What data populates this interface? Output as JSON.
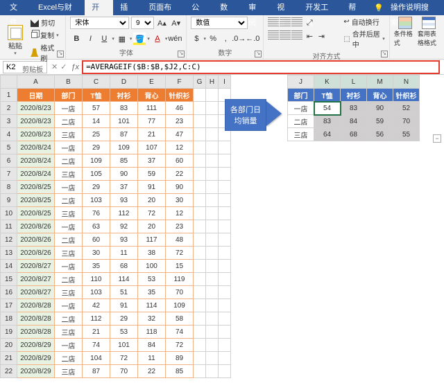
{
  "titlebar": {
    "tabs": [
      "文件",
      "Excel与财务",
      "开始",
      "插入",
      "页面布局",
      "公式",
      "数据",
      "审阅",
      "视图",
      "开发工具",
      "帮助"
    ],
    "active_index": 2,
    "tell_me": "操作说明搜索"
  },
  "ribbon": {
    "clipboard": {
      "paste": "粘贴",
      "cut": "剪切",
      "copy": "复制",
      "brush": "格式刷",
      "label": "剪贴板"
    },
    "font": {
      "name": "宋体",
      "size": "9",
      "label": "字体"
    },
    "number": {
      "format": "数值",
      "label": "数字"
    },
    "align": {
      "wrap": "自动换行",
      "merge": "合并后居中",
      "label": "对齐方式"
    },
    "styles": {
      "cond": "条件格式",
      "table": "套用表格格式"
    }
  },
  "formula_bar": {
    "name_box": "K2",
    "formula": "=AVERAGEIF($B:$B,$J2,C:C)"
  },
  "columns_left": [
    "A",
    "B",
    "C",
    "D",
    "E",
    "F",
    "G",
    "H",
    "I"
  ],
  "columns_right": [
    "J",
    "K",
    "L",
    "M",
    "N"
  ],
  "left_header": [
    "日期",
    "部门",
    "T恤",
    "衬衫",
    "背心",
    "针织衫"
  ],
  "left_rows": [
    [
      "2020/8/23",
      "一店",
      "57",
      "83",
      "111",
      "46"
    ],
    [
      "2020/8/23",
      "二店",
      "14",
      "101",
      "77",
      "23"
    ],
    [
      "2020/8/23",
      "三店",
      "25",
      "87",
      "21",
      "47"
    ],
    [
      "2020/8/24",
      "一店",
      "29",
      "109",
      "107",
      "12"
    ],
    [
      "2020/8/24",
      "二店",
      "109",
      "85",
      "37",
      "60"
    ],
    [
      "2020/8/24",
      "三店",
      "105",
      "90",
      "59",
      "22"
    ],
    [
      "2020/8/25",
      "一店",
      "29",
      "37",
      "91",
      "90"
    ],
    [
      "2020/8/25",
      "二店",
      "103",
      "93",
      "20",
      "30"
    ],
    [
      "2020/8/25",
      "三店",
      "76",
      "112",
      "72",
      "12"
    ],
    [
      "2020/8/26",
      "一店",
      "63",
      "92",
      "20",
      "23"
    ],
    [
      "2020/8/26",
      "二店",
      "60",
      "93",
      "117",
      "48"
    ],
    [
      "2020/8/26",
      "三店",
      "30",
      "11",
      "38",
      "72"
    ],
    [
      "2020/8/27",
      "一店",
      "35",
      "68",
      "100",
      "15"
    ],
    [
      "2020/8/27",
      "二店",
      "110",
      "114",
      "53",
      "119"
    ],
    [
      "2020/8/27",
      "三店",
      "103",
      "51",
      "35",
      "70"
    ],
    [
      "2020/8/28",
      "一店",
      "42",
      "91",
      "114",
      "109"
    ],
    [
      "2020/8/28",
      "二店",
      "112",
      "29",
      "32",
      "58"
    ],
    [
      "2020/8/28",
      "三店",
      "21",
      "53",
      "118",
      "74"
    ],
    [
      "2020/8/29",
      "一店",
      "74",
      "101",
      "84",
      "72"
    ],
    [
      "2020/8/29",
      "二店",
      "104",
      "72",
      "11",
      "89"
    ],
    [
      "2020/8/29",
      "三店",
      "87",
      "70",
      "22",
      "85"
    ]
  ],
  "right_header": [
    "部门",
    "T恤",
    "衬衫",
    "背心",
    "针织衫"
  ],
  "right_rows": [
    [
      "一店",
      "54",
      "83",
      "90",
      "52"
    ],
    [
      "二店",
      "83",
      "84",
      "59",
      "70"
    ],
    [
      "三店",
      "64",
      "68",
      "56",
      "55"
    ]
  ],
  "callout": "各部门日均销量",
  "chart_data": {
    "type": "table",
    "title": "各部门日均销量",
    "columns": [
      "部门",
      "T恤",
      "衬衫",
      "背心",
      "针织衫"
    ],
    "rows": [
      {
        "部门": "一店",
        "T恤": 54,
        "衬衫": 83,
        "背心": 90,
        "针织衫": 52
      },
      {
        "部门": "二店",
        "T恤": 83,
        "衬衫": 84,
        "背心": 59,
        "针织衫": 70
      },
      {
        "部门": "三店",
        "T恤": 64,
        "衬衫": 68,
        "背心": 56,
        "针织衫": 55
      }
    ]
  }
}
